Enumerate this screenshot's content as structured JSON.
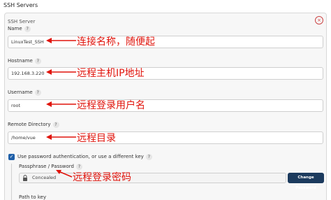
{
  "section": {
    "title": "SSH Servers"
  },
  "panel": {
    "subtitle": "SSH Server",
    "close_symbol": "×",
    "help_symbol": "?",
    "name": {
      "label": "Name",
      "value": "LinuxTest_SSH",
      "annotation": "连接名称，随便起"
    },
    "hostname": {
      "label": "Hostname",
      "value": "192.168.3.220",
      "annotation": "远程主机IP地址"
    },
    "username": {
      "label": "Username",
      "value": "root",
      "annotation": "远程登录用户名"
    },
    "remote_directory": {
      "label": "Remote Directory",
      "value": "/home/vue",
      "annotation": "远程目录"
    },
    "use_password": {
      "label": "Use password authentication, or use a different key",
      "checked": true,
      "check_symbol": "✓"
    },
    "passphrase": {
      "label": "Passphrase / Password",
      "value": "Concealed",
      "annotation": "远程登录密码",
      "button": "Change Password"
    },
    "path_to_key": {
      "label": "Path to key"
    }
  },
  "colors": {
    "annotation": "#e0140c",
    "checkbox": "#1f5fa8",
    "button": "#1c3b5e"
  },
  "icons": {
    "lock": "lock-icon",
    "close": "close-icon",
    "arrow": "arrow-left-icon"
  }
}
